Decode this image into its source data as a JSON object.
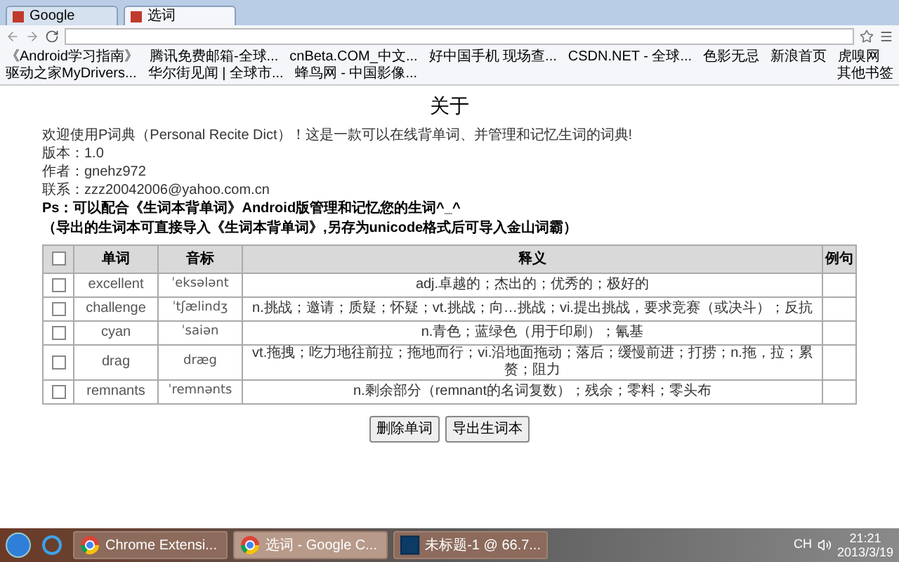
{
  "browser": {
    "tabs": [
      {
        "title": "Google",
        "selected": false
      },
      {
        "title": "选词",
        "selected": true
      }
    ],
    "bookmarks": [
      "《Android学习指南》",
      "腾讯免费邮箱-全球...",
      "cnBeta.COM_中文...",
      "好中国手机 现场查...",
      "CSDN.NET - 全球...",
      "色影无忌",
      "新浪首页",
      "虎嗅网",
      "驱动之家MyDrivers...",
      "华尔街见闻 | 全球市...",
      "蜂鸟网 - 中国影像..."
    ],
    "other_bookmarks": "其他书签"
  },
  "page": {
    "title": "关于",
    "intro": [
      "欢迎使用P词典（Personal Recite Dict）！这是一款可以在线背单词、并管理和记忆生词的词典!",
      "版本：1.0",
      "作者：gnehz972",
      "联系：zzz20042006@yahoo.com.cn"
    ],
    "notes": [
      "Ps：可以配合《生词本背单词》Android版管理和记忆您的生词^_^",
      "（导出的生词本可直接导入《生词本背单词》,另存为unicode格式后可导入金山词霸）"
    ],
    "table": {
      "select_all_checked": false,
      "columns": [
        "单词",
        "音标",
        "释义",
        "例句"
      ],
      "rows": [
        {
          "checked": false,
          "word": "excellent",
          "phonetic": "ˈeksələnt",
          "meaning": "adj.卓越的；杰出的；优秀的；极好的"
        },
        {
          "checked": false,
          "word": "challenge",
          "phonetic": "ˈtʃælindʒ",
          "meaning": "n.挑战；邀请；质疑；怀疑；vt.挑战；向…挑战；vi.提出挑战，要求竞赛（或决斗）；反抗"
        },
        {
          "checked": false,
          "word": "cyan",
          "phonetic": "ˈsaiən",
          "meaning": "n.青色；蓝绿色（用于印刷）；氰基"
        },
        {
          "checked": false,
          "word": "drag",
          "phonetic": "dræg",
          "meaning": "vt.拖拽；吃力地往前拉；拖地而行；vi.沿地面拖动；落后；缓慢前进；打捞；n.拖，拉；累赘；阻力"
        },
        {
          "checked": false,
          "word": "remnants",
          "phonetic": "ˈremnənts",
          "meaning": "n.剩余部分（remnant的名词复数）；残余；零料；零头布"
        }
      ]
    },
    "buttons": [
      "删除单词",
      "导出生词本"
    ]
  },
  "taskbar": {
    "windows": [
      {
        "title": "Chrome Extensi...",
        "kind": "chrome",
        "selected": false
      },
      {
        "title": "选词 - Google C...",
        "kind": "chrome",
        "selected": true
      },
      {
        "title": "未标题-1 @ 66.7...",
        "kind": "photoshop",
        "selected": false
      }
    ],
    "language": "CH",
    "time": "21:21",
    "date": "2013/3/19"
  }
}
